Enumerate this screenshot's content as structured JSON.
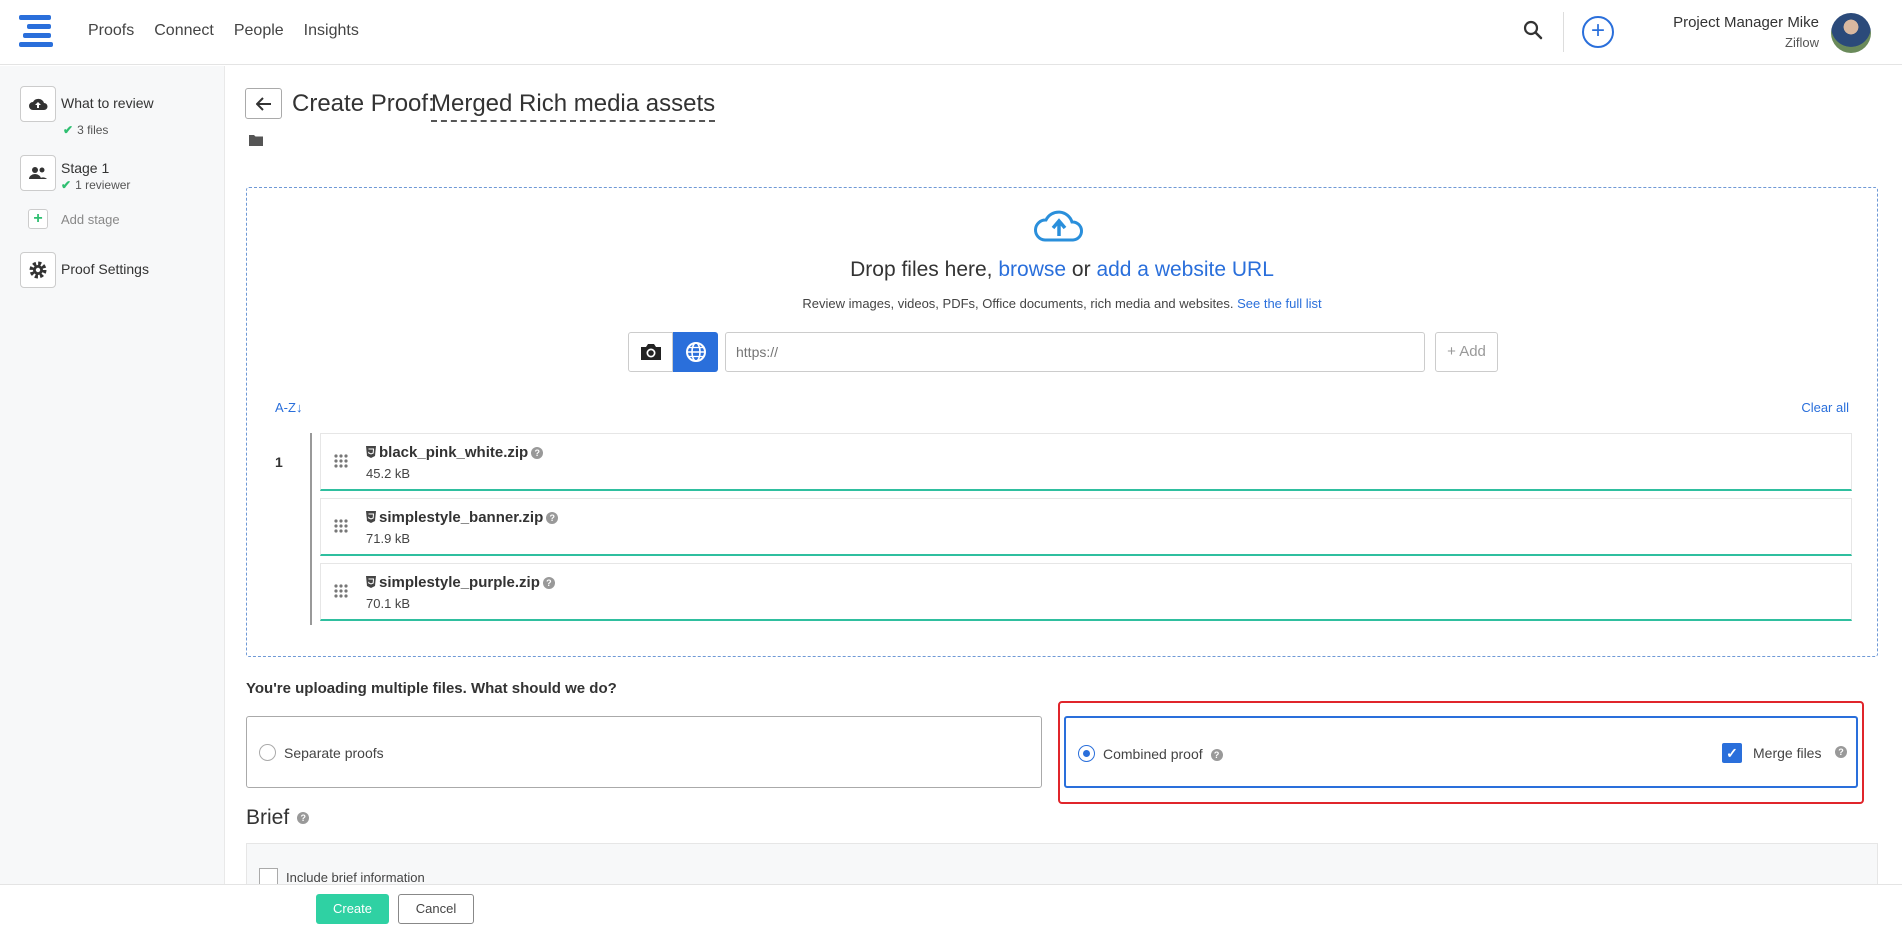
{
  "nav": {
    "items": [
      "Proofs",
      "Connect",
      "People",
      "Insights"
    ],
    "user_name": "Project Manager Mike",
    "user_org": "Ziflow",
    "icons": {
      "logo": "menu-logo-icon",
      "search": "search-icon",
      "create": "plus-circle-icon"
    }
  },
  "sidebar": {
    "what_to_review": {
      "title": "What to review",
      "sub": "3 files"
    },
    "stage": {
      "title": "Stage 1",
      "sub": "1 reviewer"
    },
    "add_stage": "Add stage",
    "proof_settings": "Proof Settings"
  },
  "header": {
    "title_prefix": "Create Proof:",
    "proof_name": "Merged Rich media assets"
  },
  "dropzone": {
    "drop_prefix": "Drop files here,",
    "browse": "browse",
    "or": "or",
    "add_url": "add a website URL",
    "sub_text": "Review images, videos, PDFs, Office documents, rich media and websites.",
    "see_full_list": "See the full list",
    "url_placeholder": "https://",
    "add_button": "+ Add",
    "sort_label": "A-Z",
    "clear_all": "Clear all",
    "group_number": "1"
  },
  "files": [
    {
      "name": "black_pink_white.zip",
      "size": "45.2 kB"
    },
    {
      "name": "simplestyle_banner.zip",
      "size": "71.9 kB"
    },
    {
      "name": "simplestyle_purple.zip",
      "size": "70.1 kB"
    }
  ],
  "multiple": {
    "question": "You're uploading multiple files. What should we do?",
    "separate": "Separate proofs",
    "combined": "Combined proof",
    "merge": "Merge files",
    "selected": "combined",
    "merge_checked": true
  },
  "brief": {
    "title": "Brief",
    "include": "Include brief information"
  },
  "footer": {
    "create": "Create",
    "cancel": "Cancel"
  },
  "colors": {
    "accent": "#2a6fdb",
    "success": "#2fd1a3",
    "highlight": "#e0252b"
  }
}
